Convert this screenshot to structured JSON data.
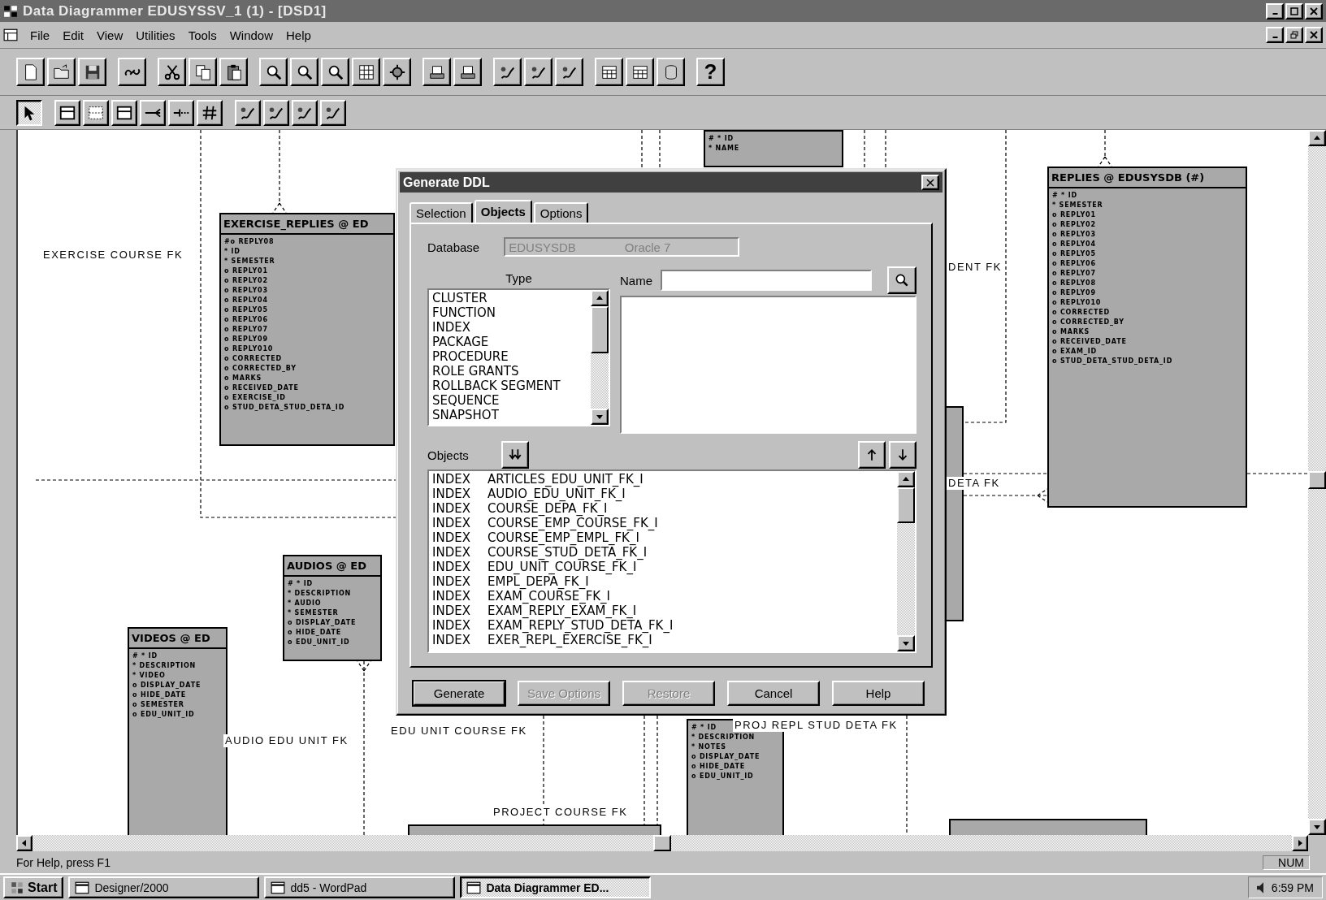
{
  "window": {
    "title": "Data Diagrammer EDUSYSSV_1 (1) - [DSD1]"
  },
  "menu": [
    "File",
    "Edit",
    "View",
    "Utilities",
    "Tools",
    "Window",
    "Help"
  ],
  "toolbar": {
    "help_label": "?"
  },
  "palette": [
    {
      "selected": true
    },
    {
      "selected": false
    },
    {
      "selected": false
    },
    {
      "selected": false
    },
    {
      "selected": false
    },
    {
      "selected": false
    },
    {
      "selected": false
    },
    {
      "selected": false
    },
    {
      "selected": false
    },
    {
      "selected": false
    },
    {
      "selected": false
    }
  ],
  "diagram": {
    "entities": [
      {
        "kind": "entity",
        "attributes": [
          "# * ID",
          "* NAME"
        ]
      },
      {
        "kind": "entity",
        "title": "EXERCISE_REPLIES @ ED",
        "attributes": [
          "#o REPLY08",
          "* ID",
          "* SEMESTER",
          "o REPLY01",
          "o REPLY02",
          "o REPLY03",
          "o REPLY04",
          "o REPLY05",
          "o REPLY06",
          "o REPLY07",
          "o REPLY09",
          "o REPLY010",
          "o CORRECTED",
          "o CORRECTED_BY",
          "o MARKS",
          "o RECEIVED_DATE",
          "o EXERCISE_ID",
          "o STUD_DETA_STUD_DETA_ID"
        ]
      },
      {
        "kind": "entity",
        "title": "REPLIES @ EDUSYSDB (#)",
        "attributes": [
          "# * ID",
          "* SEMESTER",
          "o REPLY01",
          "o REPLY02",
          "o REPLY03",
          "o REPLY04",
          "o REPLY05",
          "o REPLY06",
          "o REPLY07",
          "o REPLY08",
          "o REPLY09",
          "o REPLY010",
          "o CORRECTED",
          "o CORRECTED_BY",
          "o MARKS",
          "o RECEIVED_DATE",
          "o EXAM_ID",
          "o STUD_DETA_STUD_DETA_ID"
        ]
      },
      {
        "kind": "stub"
      },
      {
        "kind": "entity",
        "title": "AUDIOS @ ED",
        "attributes": [
          "# * ID",
          "* DESCRIPTION",
          "* AUDIO",
          "* SEMESTER",
          "o DISPLAY_DATE",
          "o HIDE_DATE",
          "o EDU_UNIT_ID"
        ]
      },
      {
        "kind": "entity",
        "title": "VIDEOS @ ED",
        "attributes": [
          "# * ID",
          "* DESCRIPTION",
          "* VIDEO",
          "o DISPLAY_DATE",
          "o HIDE_DATE",
          "o SEMESTER",
          "o EDU_UNIT_ID"
        ]
      },
      {
        "kind": "entity",
        "attributes": [
          "# * ID",
          "* DESCRIPTION",
          "* NOTES",
          "o DISPLAY_DATE",
          "o HIDE_DATE",
          "o EDU_UNIT_ID"
        ]
      },
      {
        "kind": "stub"
      },
      {
        "kind": "stub"
      }
    ],
    "relationships": [
      "EXERCISE COURSE FK",
      "DENT FK",
      "DETA FK",
      "PROJ REPL STUD DETA FK",
      "EDU UNIT COURSE FK",
      "AUDIO EDU UNIT FK",
      "PROJECT COURSE FK"
    ]
  },
  "dialog": {
    "title": "Generate DDL",
    "tabs": [
      {
        "label": "Selection",
        "selected": false
      },
      {
        "label": "Objects",
        "selected": true
      },
      {
        "label": "Options",
        "selected": false
      }
    ],
    "database": {
      "label": "Database",
      "value": "EDUSYSDB",
      "version": "Oracle 7",
      "disabled": true
    },
    "type_label": "Type",
    "types": [
      "CLUSTER",
      "FUNCTION",
      "INDEX",
      "PACKAGE",
      "PROCEDURE",
      "ROLE GRANTS",
      "ROLLBACK SEGMENT",
      "SEQUENCE",
      "SNAPSHOT"
    ],
    "name_label": "Name",
    "objects_label": "Objects",
    "objects": [
      {
        "type": "INDEX",
        "name": "ARTICLES_EDU_UNIT_FK_I"
      },
      {
        "type": "INDEX",
        "name": "AUDIO_EDU_UNIT_FK_I"
      },
      {
        "type": "INDEX",
        "name": "COURSE_DEPA_FK_I"
      },
      {
        "type": "INDEX",
        "name": "COURSE_EMP_COURSE_FK_I"
      },
      {
        "type": "INDEX",
        "name": "COURSE_EMP_EMPL_FK_I"
      },
      {
        "type": "INDEX",
        "name": "COURSE_STUD_DETA_FK_I"
      },
      {
        "type": "INDEX",
        "name": "EDU_UNIT_COURSE_FK_I"
      },
      {
        "type": "INDEX",
        "name": "EMPL_DEPA_FK_I"
      },
      {
        "type": "INDEX",
        "name": "EXAM_COURSE_FK_I"
      },
      {
        "type": "INDEX",
        "name": "EXAM_REPLY_EXAM_FK_I"
      },
      {
        "type": "INDEX",
        "name": "EXAM_REPLY_STUD_DETA_FK_I"
      },
      {
        "type": "INDEX",
        "name": "EXER_REPL_EXERCISE_FK_I"
      }
    ],
    "buttons": [
      {
        "label": "Generate",
        "default": true,
        "disabled": false
      },
      {
        "label": "Save Options",
        "default": false,
        "disabled": true
      },
      {
        "label": "Restore",
        "default": false,
        "disabled": true
      },
      {
        "label": "Cancel",
        "default": false,
        "disabled": false
      },
      {
        "label": "Help",
        "default": false,
        "disabled": false
      }
    ]
  },
  "status_bar": {
    "message": "For Help, press F1",
    "indicator": "NUM"
  },
  "taskbar": {
    "start": "Start",
    "tasks": [
      {
        "label": "Designer/2000",
        "selected": false
      },
      {
        "label": "dd5 - WordPad",
        "selected": false
      },
      {
        "label": "Data Diagrammer ED...",
        "selected": true
      }
    ],
    "clock": "6:59 PM"
  }
}
